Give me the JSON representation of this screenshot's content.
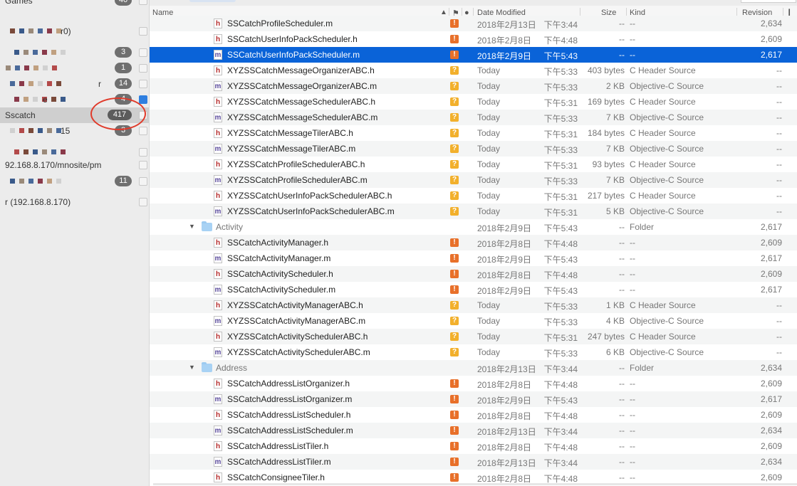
{
  "sidebar": {
    "items": [
      {
        "label": "Games",
        "badge": "40"
      },
      {
        "label": "",
        "suffix": "r0)",
        "badge": ""
      },
      {
        "label": "",
        "badge": "3"
      },
      {
        "label": "",
        "badge": "1"
      },
      {
        "label": "",
        "suffix": "r",
        "badge": "14"
      },
      {
        "label": "",
        "suffix": "e",
        "badge": "4"
      },
      {
        "label": "Sscatch",
        "badge": "417",
        "selected": true
      },
      {
        "label": "",
        "suffix": "15",
        "badge": "3"
      },
      {
        "label": "",
        "badge": ""
      },
      {
        "label": "92.168.8.170/mnosite/pm",
        "badge": ""
      },
      {
        "label": "",
        "badge": "11"
      },
      {
        "label": "r (192.168.8.170)",
        "badge": ""
      }
    ],
    "highlight_color": "#e03a2a"
  },
  "columns": {
    "name": "Name",
    "date": "Date Modified",
    "size": "Size",
    "kind": "Kind",
    "revision": "Revision"
  },
  "rows": [
    {
      "type": "file",
      "icon": "h",
      "name": "SSCatchProfileScheduler.m",
      "status": "!",
      "date": "2018年2月13日",
      "time": "下午3:44",
      "size": "--",
      "kind": "--",
      "revision": "2,634"
    },
    {
      "type": "file",
      "icon": "h",
      "name": "SSCatchUserInfoPackScheduler.h",
      "status": "!",
      "date": "2018年2月8日",
      "time": "下午4:48",
      "size": "--",
      "kind": "--",
      "revision": "2,609"
    },
    {
      "type": "file",
      "icon": "m",
      "name": "SSCatchUserInfoPackScheduler.m",
      "status": "!",
      "date": "2018年2月9日",
      "time": "下午5:43",
      "size": "--",
      "kind": "--",
      "revision": "2,617",
      "selected": true
    },
    {
      "type": "file",
      "icon": "h",
      "name": "XYZSSCatchMessageOrganizerABC.h",
      "status": "?",
      "date": "Today",
      "time": "下午5:33",
      "size": "403 bytes",
      "kind": "C Header Source",
      "revision": "--"
    },
    {
      "type": "file",
      "icon": "m",
      "name": "XYZSSCatchMessageOrganizerABC.m",
      "status": "?",
      "date": "Today",
      "time": "下午5:33",
      "size": "2 KB",
      "kind": "Objective-C Source",
      "revision": "--"
    },
    {
      "type": "file",
      "icon": "h",
      "name": "XYZSSCatchMessageSchedulerABC.h",
      "status": "?",
      "date": "Today",
      "time": "下午5:31",
      "size": "169 bytes",
      "kind": "C Header Source",
      "revision": "--"
    },
    {
      "type": "file",
      "icon": "m",
      "name": "XYZSSCatchMessageSchedulerABC.m",
      "status": "?",
      "date": "Today",
      "time": "下午5:33",
      "size": "7 KB",
      "kind": "Objective-C Source",
      "revision": "--"
    },
    {
      "type": "file",
      "icon": "h",
      "name": "XYZSSCatchMessageTilerABC.h",
      "status": "?",
      "date": "Today",
      "time": "下午5:31",
      "size": "184 bytes",
      "kind": "C Header Source",
      "revision": "--"
    },
    {
      "type": "file",
      "icon": "m",
      "name": "XYZSSCatchMessageTilerABC.m",
      "status": "?",
      "date": "Today",
      "time": "下午5:33",
      "size": "7 KB",
      "kind": "Objective-C Source",
      "revision": "--"
    },
    {
      "type": "file",
      "icon": "h",
      "name": "XYZSSCatchProfileSchedulerABC.h",
      "status": "?",
      "date": "Today",
      "time": "下午5:31",
      "size": "93 bytes",
      "kind": "C Header Source",
      "revision": "--"
    },
    {
      "type": "file",
      "icon": "m",
      "name": "XYZSSCatchProfileSchedulerABC.m",
      "status": "?",
      "date": "Today",
      "time": "下午5:33",
      "size": "7 KB",
      "kind": "Objective-C Source",
      "revision": "--"
    },
    {
      "type": "file",
      "icon": "h",
      "name": "XYZSSCatchUserInfoPackSchedulerABC.h",
      "status": "?",
      "date": "Today",
      "time": "下午5:31",
      "size": "217 bytes",
      "kind": "C Header Source",
      "revision": "--"
    },
    {
      "type": "file",
      "icon": "m",
      "name": "XYZSSCatchUserInfoPackSchedulerABC.m",
      "status": "?",
      "date": "Today",
      "time": "下午5:31",
      "size": "5 KB",
      "kind": "Objective-C Source",
      "revision": "--"
    },
    {
      "type": "folder",
      "name": "Activity",
      "status": "",
      "date": "2018年2月9日",
      "time": "下午5:43",
      "size": "--",
      "kind": "Folder",
      "revision": "2,617"
    },
    {
      "type": "file",
      "icon": "h",
      "name": "SSCatchActivityManager.h",
      "status": "!",
      "date": "2018年2月8日",
      "time": "下午4:48",
      "size": "--",
      "kind": "--",
      "revision": "2,609"
    },
    {
      "type": "file",
      "icon": "m",
      "name": "SSCatchActivityManager.m",
      "status": "!",
      "date": "2018年2月9日",
      "time": "下午5:43",
      "size": "--",
      "kind": "--",
      "revision": "2,617"
    },
    {
      "type": "file",
      "icon": "h",
      "name": "SSCatchActivityScheduler.h",
      "status": "!",
      "date": "2018年2月8日",
      "time": "下午4:48",
      "size": "--",
      "kind": "--",
      "revision": "2,609"
    },
    {
      "type": "file",
      "icon": "m",
      "name": "SSCatchActivityScheduler.m",
      "status": "!",
      "date": "2018年2月9日",
      "time": "下午5:43",
      "size": "--",
      "kind": "--",
      "revision": "2,617"
    },
    {
      "type": "file",
      "icon": "h",
      "name": "XYZSSCatchActivityManagerABC.h",
      "status": "?",
      "date": "Today",
      "time": "下午5:33",
      "size": "1 KB",
      "kind": "C Header Source",
      "revision": "--"
    },
    {
      "type": "file",
      "icon": "m",
      "name": "XYZSSCatchActivityManagerABC.m",
      "status": "?",
      "date": "Today",
      "time": "下午5:33",
      "size": "4 KB",
      "kind": "Objective-C Source",
      "revision": "--"
    },
    {
      "type": "file",
      "icon": "h",
      "name": "XYZSSCatchActivitySchedulerABC.h",
      "status": "?",
      "date": "Today",
      "time": "下午5:31",
      "size": "247 bytes",
      "kind": "C Header Source",
      "revision": "--"
    },
    {
      "type": "file",
      "icon": "m",
      "name": "XYZSSCatchActivitySchedulerABC.m",
      "status": "?",
      "date": "Today",
      "time": "下午5:33",
      "size": "6 KB",
      "kind": "Objective-C Source",
      "revision": "--"
    },
    {
      "type": "folder",
      "name": "Address",
      "status": "",
      "date": "2018年2月13日",
      "time": "下午3:44",
      "size": "--",
      "kind": "Folder",
      "revision": "2,634"
    },
    {
      "type": "file",
      "icon": "h",
      "name": "SSCatchAddressListOrganizer.h",
      "status": "!",
      "date": "2018年2月8日",
      "time": "下午4:48",
      "size": "--",
      "kind": "--",
      "revision": "2,609"
    },
    {
      "type": "file",
      "icon": "m",
      "name": "SSCatchAddressListOrganizer.m",
      "status": "!",
      "date": "2018年2月9日",
      "time": "下午5:43",
      "size": "--",
      "kind": "--",
      "revision": "2,617"
    },
    {
      "type": "file",
      "icon": "h",
      "name": "SSCatchAddressListScheduler.h",
      "status": "!",
      "date": "2018年2月8日",
      "time": "下午4:48",
      "size": "--",
      "kind": "--",
      "revision": "2,609"
    },
    {
      "type": "file",
      "icon": "m",
      "name": "SSCatchAddressListScheduler.m",
      "status": "!",
      "date": "2018年2月13日",
      "time": "下午3:44",
      "size": "--",
      "kind": "--",
      "revision": "2,634"
    },
    {
      "type": "file",
      "icon": "h",
      "name": "SSCatchAddressListTiler.h",
      "status": "!",
      "date": "2018年2月8日",
      "time": "下午4:48",
      "size": "--",
      "kind": "--",
      "revision": "2,609"
    },
    {
      "type": "file",
      "icon": "m",
      "name": "SSCatchAddressListTiler.m",
      "status": "!",
      "date": "2018年2月13日",
      "time": "下午3:44",
      "size": "--",
      "kind": "--",
      "revision": "2,634"
    },
    {
      "type": "file",
      "icon": "h",
      "name": "SSCatchConsigneeTiler.h",
      "status": "!",
      "date": "2018年2月8日",
      "time": "下午4:48",
      "size": "--",
      "kind": "--",
      "revision": "2,609"
    }
  ]
}
